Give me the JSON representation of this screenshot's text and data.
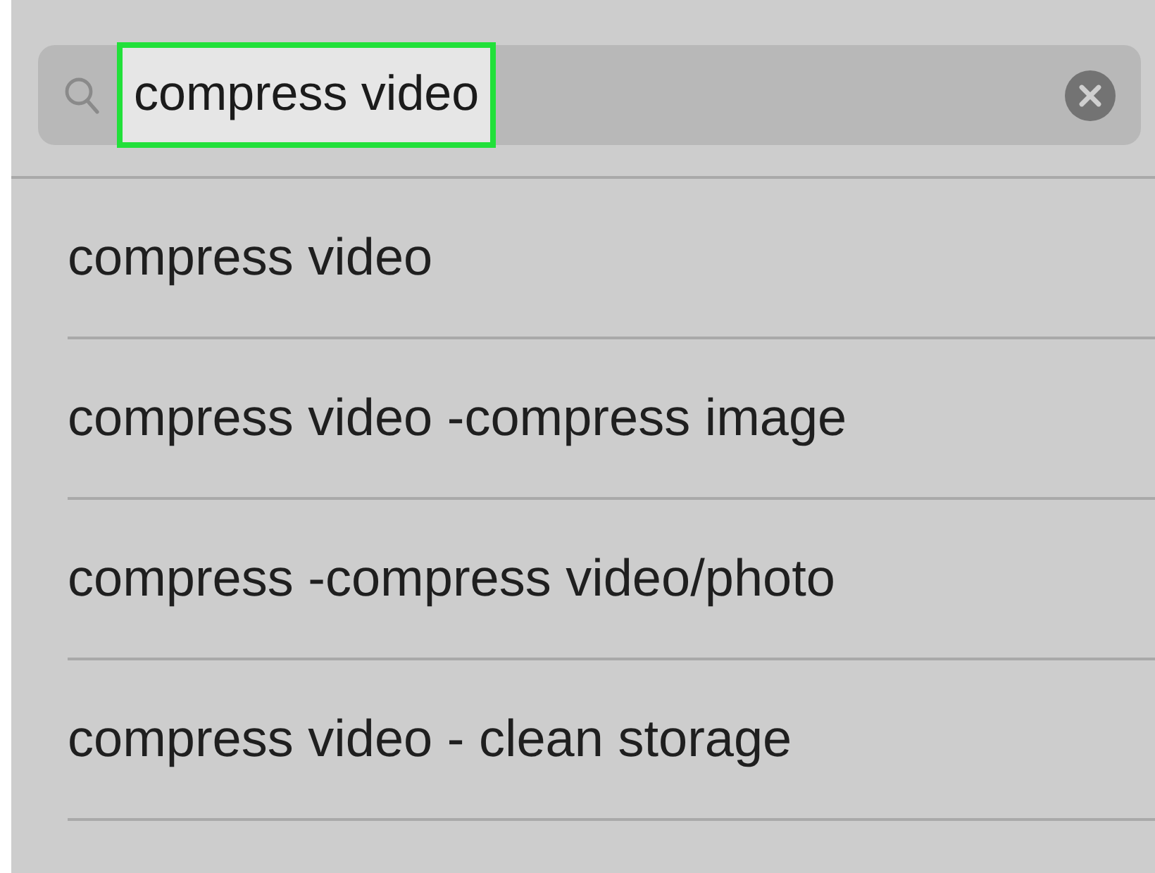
{
  "search": {
    "value": "compress video",
    "highlighted": true
  },
  "suggestions": [
    "compress video",
    "compress video -compress image",
    "compress -compress video/photo",
    "compress video - clean storage"
  ]
}
